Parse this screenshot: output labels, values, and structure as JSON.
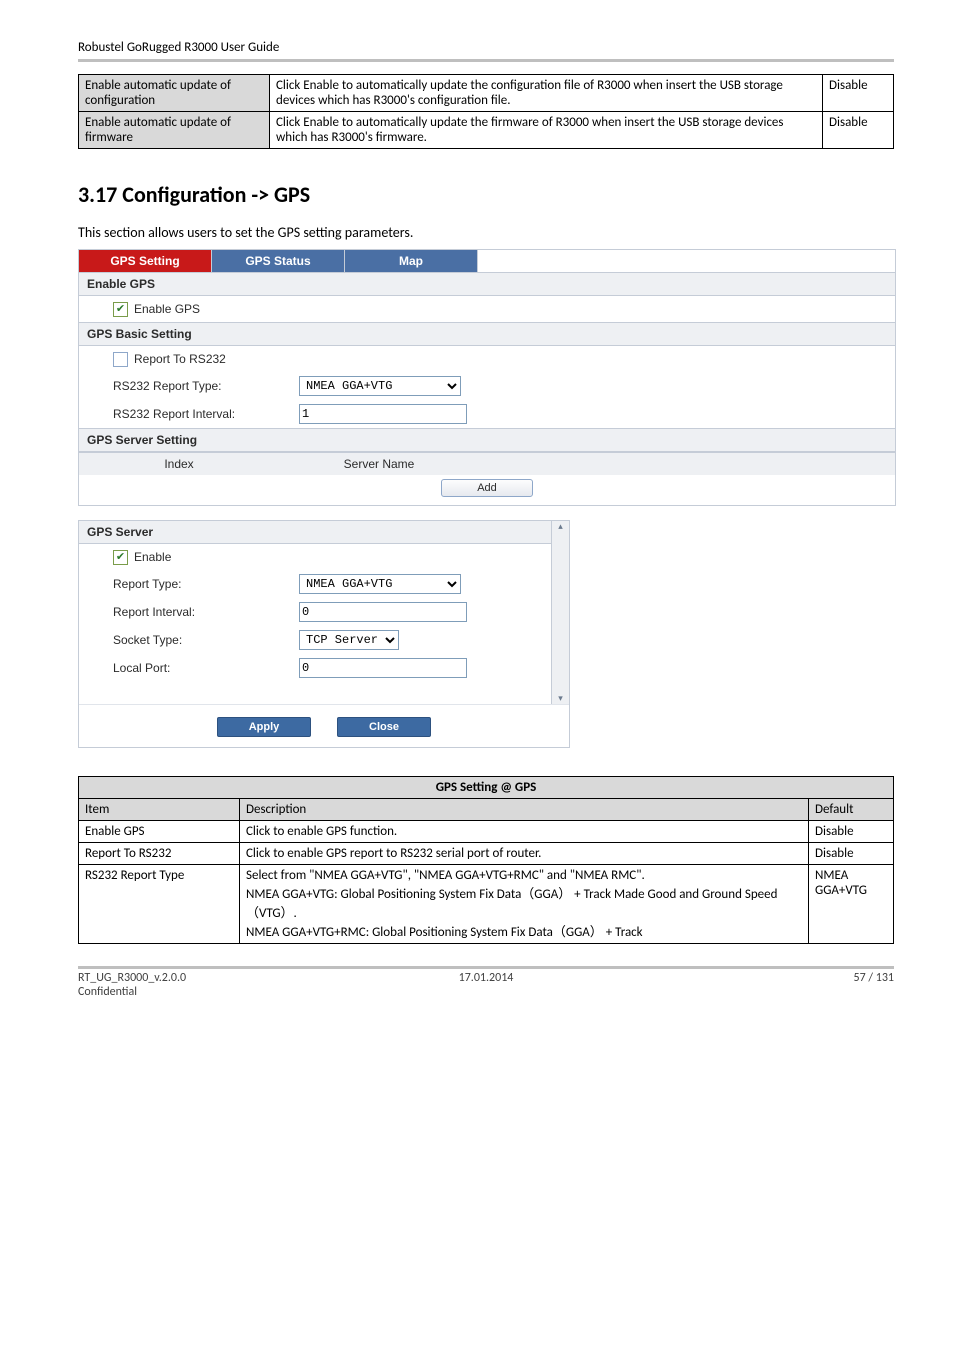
{
  "header": {
    "title": "Robustel GoRugged R3000 User Guide"
  },
  "topTable": {
    "rows": [
      {
        "c1": "Enable automatic update of configuration",
        "c2": "Click Enable to automatically update the configuration file of R3000 when insert the USB storage devices which has R3000's configuration file.",
        "c3": "Disable"
      },
      {
        "c1": "Enable automatic update of firmware",
        "c2": "Click Enable to automatically update the firmware of R3000 when insert the USB storage devices which has R3000's firmware.",
        "c3": "Disable"
      }
    ]
  },
  "heading": "3.17  Configuration -> GPS",
  "intro": "This section allows users to set the GPS setting parameters.",
  "shot1": {
    "tabs": [
      "GPS Setting",
      "GPS Status",
      "Map"
    ],
    "sections": {
      "enableGps": {
        "band": "Enable GPS",
        "label": "Enable GPS"
      },
      "basic": {
        "band": "GPS Basic Setting",
        "reportTo": "Report To RS232",
        "typeLabel": "RS232 Report Type:",
        "typeValue": "NMEA GGA+VTG",
        "intervalLabel": "RS232 Report Interval:",
        "intervalValue": "1"
      },
      "server": {
        "band": "GPS Server Setting",
        "colIndex": "Index",
        "colName": "Server Name",
        "addBtn": "Add"
      }
    }
  },
  "shot2": {
    "band": "GPS Server",
    "enable": "Enable",
    "rows": {
      "type": {
        "label": "Report Type:",
        "value": "NMEA GGA+VTG"
      },
      "interval": {
        "label": "Report Interval:",
        "value": "0"
      },
      "socket": {
        "label": "Socket Type:",
        "value": "TCP Server"
      },
      "port": {
        "label": "Local Port:",
        "value": "0"
      }
    },
    "apply": "Apply",
    "close": "Close"
  },
  "gpsTable": {
    "caption": "GPS Setting @ GPS",
    "head": {
      "item": "Item",
      "desc": "Description",
      "def": "Default"
    },
    "rows": [
      {
        "item": "Enable GPS",
        "desc": "Click to enable GPS function.",
        "def": "Disable"
      },
      {
        "item": "Report To RS232",
        "desc": "Click to enable GPS report to RS232 serial port of router.",
        "def": "Disable"
      },
      {
        "item": "RS232 Report Type",
        "desc": "Select from \"NMEA GGA+VTG\", \"NMEA GGA+VTG+RMC\" and \"NMEA RMC\".\nNMEA GGA+VTG: Global Positioning System Fix Data（GGA） + Track Made Good and Ground Speed（VTG）.\nNMEA GGA+VTG+RMC: Global Positioning System Fix Data（GGA） + Track",
        "def": "NMEA GGA+VTG"
      }
    ]
  },
  "footer": {
    "left1": "RT_UG_R3000_v.2.0.0",
    "left2": "Confidential",
    "center": "17.01.2014",
    "right": "57 / 131"
  }
}
